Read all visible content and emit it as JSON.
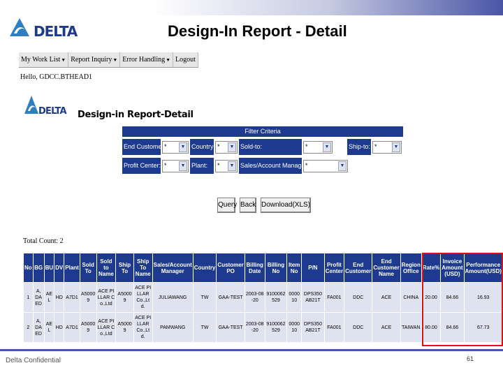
{
  "slide": {
    "title": "Design-In Report - Detail",
    "footer": "Delta Confidential",
    "page_number": "61",
    "brand_color": "#1d3a8e"
  },
  "app": {
    "menu": [
      {
        "label": "My Work List",
        "caret": "▼"
      },
      {
        "label": "Report Inquiry",
        "caret": "▼"
      },
      {
        "label": "Error Handling",
        "caret": "▼"
      },
      {
        "label": "Logout",
        "caret": ""
      }
    ],
    "greeting": "Hello, GDCC.BTHEAD1",
    "report_title": "Design-in Report-Detail",
    "filter": {
      "header": "Filter Criteria",
      "end_customer": {
        "label": "End Customer:",
        "value": "*"
      },
      "country": {
        "label": "Country:",
        "value": "*"
      },
      "sold_to": {
        "label": "Sold-to:",
        "value": "*"
      },
      "ship_to": {
        "label": "Ship-to:",
        "value": "*"
      },
      "profit_center": {
        "label": "Profit Center:",
        "value": "*"
      },
      "plant": {
        "label": "Plant:",
        "value": "*"
      },
      "sales_manager": {
        "label": "Sales/Account Manager:",
        "value": "*"
      }
    },
    "buttons": {
      "query": "Query",
      "back": "Back",
      "download": "Download(XLS)"
    },
    "total_count": "Total Count: 2",
    "table": {
      "headers": [
        "No",
        "BG",
        "BU",
        "DV",
        "Plant",
        "Sold To",
        "Sold to Name",
        "Ship To",
        "Ship To Name",
        "Sales/Account Manager",
        "Country",
        "Customer PO",
        "Billing Date",
        "Billing No",
        "Item No",
        "P/N",
        "Profit Center",
        "End Customer",
        "End Customer Name",
        "Region Office",
        "Rate%",
        "Invoice Amount (USD)",
        "Performance Amount(USD)"
      ],
      "rows": [
        [
          "1",
          "A, DAED",
          "AEL",
          "HD",
          "A7D1",
          "A50009",
          "ACE PILLAR Co.,Ltd",
          "A50009",
          "ACE PILLAR Co.,Ltd.",
          "JULIAWANG",
          "TW",
          "GAA-TEST",
          "2003-08-20",
          "9100062529",
          "000010",
          "DPS350AB21T",
          "FA001",
          "DDC",
          "ACE",
          "CHINA",
          "20.00",
          "84.66",
          "16.93"
        ],
        [
          "2",
          "A, DAED",
          "AEL",
          "HD",
          "A7D1",
          "A50009",
          "ACE PILLAR Co.,Ltd",
          "A50009",
          "ACE PILLAR Co.,Ltd.",
          "PAMWANG",
          "TW",
          "GAA-TEST",
          "2003-08-20",
          "9100062529",
          "000010",
          "DPS350AB21T",
          "FA001",
          "DDC",
          "ACE",
          "TAIWAN",
          "80.00",
          "84.66",
          "67.73"
        ]
      ]
    },
    "highlight_color": "#e01010"
  }
}
